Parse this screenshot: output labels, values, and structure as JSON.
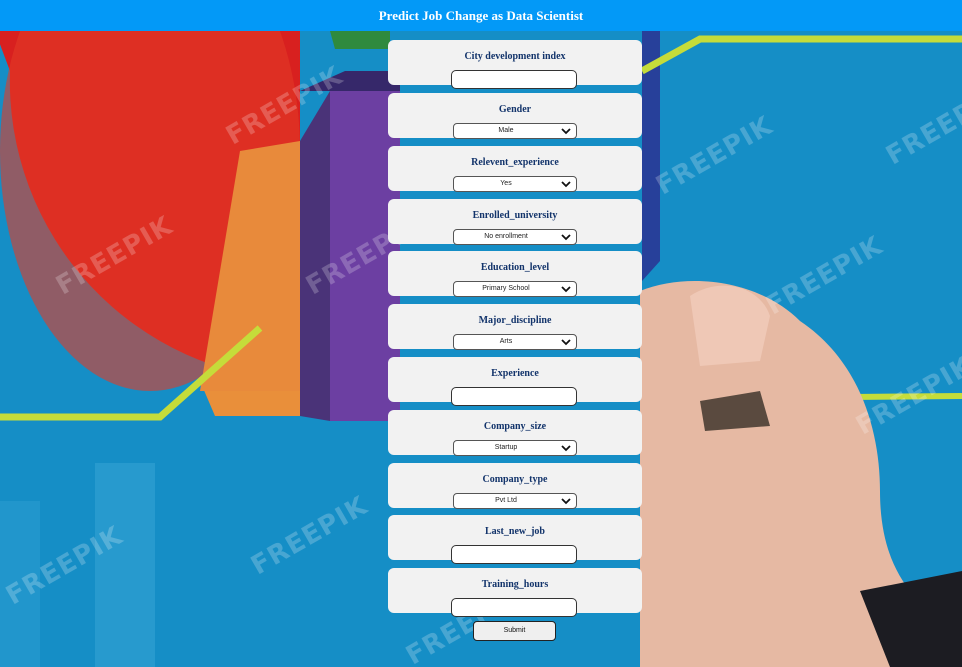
{
  "header": {
    "title": "Predict Job Change as Data Scientist"
  },
  "background": {
    "watermark": "FREEPIK"
  },
  "fields": [
    {
      "label": "City development index",
      "type": "text",
      "value": ""
    },
    {
      "label": "Gender",
      "type": "select",
      "value": "Male"
    },
    {
      "label": "Relevent_experience",
      "type": "select",
      "value": "Yes"
    },
    {
      "label": "Enrolled_university",
      "type": "select",
      "value": "No enrollment"
    },
    {
      "label": "Education_level",
      "type": "select",
      "value": "Primary School"
    },
    {
      "label": "Major_discipline",
      "type": "select",
      "value": "Arts"
    },
    {
      "label": "Experience",
      "type": "text",
      "value": ""
    },
    {
      "label": "Company_size",
      "type": "select",
      "value": "Startup"
    },
    {
      "label": "Company_type",
      "type": "select",
      "value": "Pvt Ltd"
    },
    {
      "label": "Last_new_job",
      "type": "text",
      "value": ""
    },
    {
      "label": "Training_hours",
      "type": "text",
      "value": ""
    }
  ],
  "submit_label": "Submit"
}
